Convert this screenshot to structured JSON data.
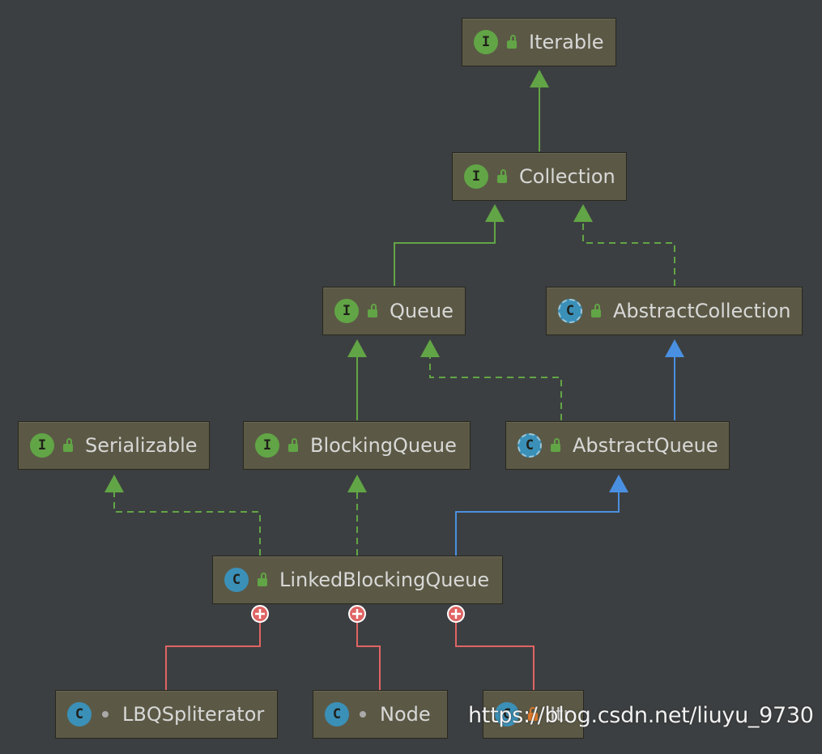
{
  "nodes": [
    {
      "id": "iterable",
      "label": "Iterable",
      "kind": "interface",
      "kind_letter": "I",
      "visibility": "public"
    },
    {
      "id": "collection",
      "label": "Collection",
      "kind": "interface",
      "kind_letter": "I",
      "visibility": "public"
    },
    {
      "id": "queue",
      "label": "Queue",
      "kind": "interface",
      "kind_letter": "I",
      "visibility": "public"
    },
    {
      "id": "abstract-collection",
      "label": "AbstractCollection",
      "kind": "abstract",
      "kind_letter": "C",
      "visibility": "public"
    },
    {
      "id": "serializable",
      "label": "Serializable",
      "kind": "interface",
      "kind_letter": "I",
      "visibility": "public"
    },
    {
      "id": "blocking-queue",
      "label": "BlockingQueue",
      "kind": "interface",
      "kind_letter": "I",
      "visibility": "public"
    },
    {
      "id": "abstract-queue",
      "label": "AbstractQueue",
      "kind": "abstract",
      "kind_letter": "C",
      "visibility": "public"
    },
    {
      "id": "linked-blocking-queue",
      "label": "LinkedBlockingQueue",
      "kind": "class",
      "kind_letter": "C",
      "visibility": "public"
    },
    {
      "id": "lbq-spliterator",
      "label": "LBQSpliterator",
      "kind": "nested",
      "kind_letter": "C",
      "visibility": "package"
    },
    {
      "id": "node",
      "label": "Node",
      "kind": "nested",
      "kind_letter": "C",
      "visibility": "package"
    },
    {
      "id": "itr",
      "label": "Itr",
      "kind": "nested",
      "kind_letter": "C",
      "visibility": "private"
    }
  ],
  "edges": [
    {
      "from": "collection",
      "to": "iterable",
      "type": "interface-extends"
    },
    {
      "from": "queue",
      "to": "collection",
      "type": "interface-extends"
    },
    {
      "from": "abstract-collection",
      "to": "collection",
      "type": "implements"
    },
    {
      "from": "blocking-queue",
      "to": "queue",
      "type": "interface-extends"
    },
    {
      "from": "abstract-queue",
      "to": "queue",
      "type": "implements"
    },
    {
      "from": "abstract-queue",
      "to": "abstract-collection",
      "type": "class-extends"
    },
    {
      "from": "linked-blocking-queue",
      "to": "serializable",
      "type": "implements"
    },
    {
      "from": "linked-blocking-queue",
      "to": "blocking-queue",
      "type": "implements"
    },
    {
      "from": "linked-blocking-queue",
      "to": "abstract-queue",
      "type": "class-extends"
    },
    {
      "from": "lbq-spliterator",
      "to": "linked-blocking-queue",
      "type": "inner-class"
    },
    {
      "from": "node",
      "to": "linked-blocking-queue",
      "type": "inner-class"
    },
    {
      "from": "itr",
      "to": "linked-blocking-queue",
      "type": "inner-class"
    }
  ],
  "colors": {
    "background": "#3c3f41",
    "interface_edge": "#62a546",
    "class_edge": "#4a90e2",
    "inner_edge": "#e06464",
    "node_fill": "#5b5945"
  },
  "watermark": "https://blog.csdn.net/liuyu_9730"
}
